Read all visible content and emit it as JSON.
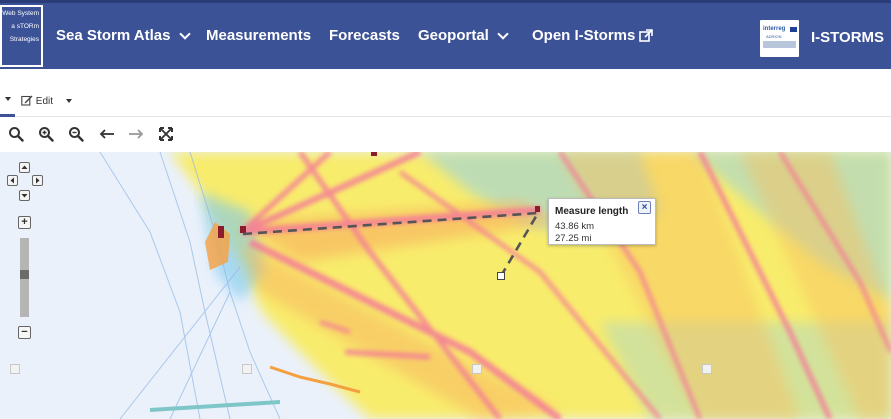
{
  "brand": {
    "lines": [
      "Web System",
      "a sTORm",
      "Strategies"
    ]
  },
  "nav": {
    "items": [
      {
        "label": "Sea Storm Atlas",
        "dropdown": true
      },
      {
        "label": "Measurements",
        "dropdown": false
      },
      {
        "label": "Forecasts",
        "dropdown": false
      },
      {
        "label": "Geoportal",
        "dropdown": true
      },
      {
        "label": "Open I-Storms",
        "dropdown": false,
        "external": true
      }
    ],
    "partner_logo": "interreg",
    "project_name": "I-STORMS"
  },
  "toolbar": {
    "edit_label": "Edit",
    "tools": [
      "search-icon",
      "zoom-in-icon",
      "zoom-out-icon",
      "arrow-left-icon",
      "arrow-right-icon",
      "fullscreen-icon"
    ]
  },
  "map": {
    "measure_popup": {
      "title": "Measure length",
      "km": "43.86 km",
      "mi": "27.25 mi"
    },
    "zoom_level_fraction": 0.4
  },
  "colors": {
    "navbar": "#3c5296",
    "sea_base": "#f9ec6a",
    "density_high": "#f4789a",
    "density_low": "#7cc9ee",
    "measure_line": "#555555"
  }
}
